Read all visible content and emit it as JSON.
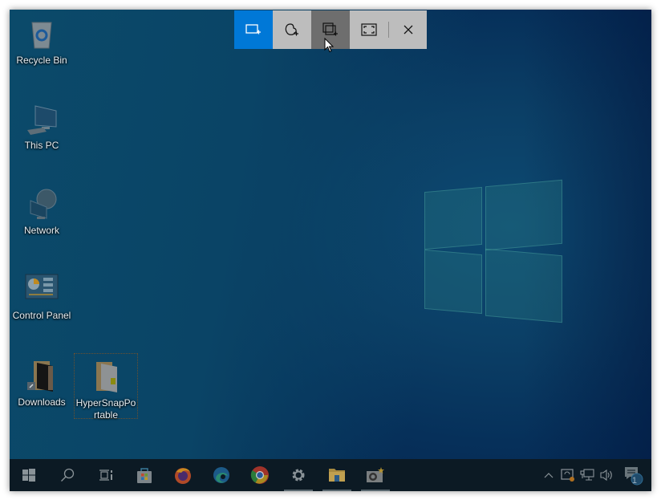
{
  "snip_toolbar": {
    "modes": [
      {
        "id": "rectangular",
        "icon": "rectangle-snip-icon",
        "state": "active"
      },
      {
        "id": "freeform",
        "icon": "freeform-snip-icon",
        "state": "normal"
      },
      {
        "id": "window",
        "icon": "window-snip-icon",
        "state": "hover"
      },
      {
        "id": "fullscreen",
        "icon": "fullscreen-snip-icon",
        "state": "normal"
      }
    ],
    "close_icon": "close-icon",
    "accent": "#0078d7"
  },
  "desktop": {
    "icons": [
      {
        "label": "Recycle Bin",
        "icon": "recycle-bin-icon"
      },
      {
        "label": "This PC",
        "icon": "this-pc-icon"
      },
      {
        "label": "Network",
        "icon": "network-icon"
      },
      {
        "label": "Control Panel",
        "icon": "control-panel-icon"
      },
      {
        "label": "Downloads",
        "icon": "folder-shortcut-icon"
      },
      {
        "label": "HyperSnapPortable",
        "icon": "folder-icon",
        "selected": true
      }
    ]
  },
  "taskbar": {
    "items": [
      {
        "name": "start",
        "icon": "windows-start-icon"
      },
      {
        "name": "search",
        "icon": "search-icon"
      },
      {
        "name": "task-view",
        "icon": "task-view-icon"
      },
      {
        "name": "microsoft-store",
        "icon": "store-icon"
      },
      {
        "name": "firefox",
        "icon": "firefox-icon"
      },
      {
        "name": "edge",
        "icon": "edge-icon"
      },
      {
        "name": "chrome",
        "icon": "chrome-icon"
      },
      {
        "name": "settings",
        "icon": "gear-icon",
        "running": true
      },
      {
        "name": "file-explorer",
        "icon": "file-explorer-icon",
        "running": true
      },
      {
        "name": "hypersnap",
        "icon": "camera-icon",
        "running": true
      }
    ],
    "tray": {
      "notification_count": "1"
    }
  }
}
